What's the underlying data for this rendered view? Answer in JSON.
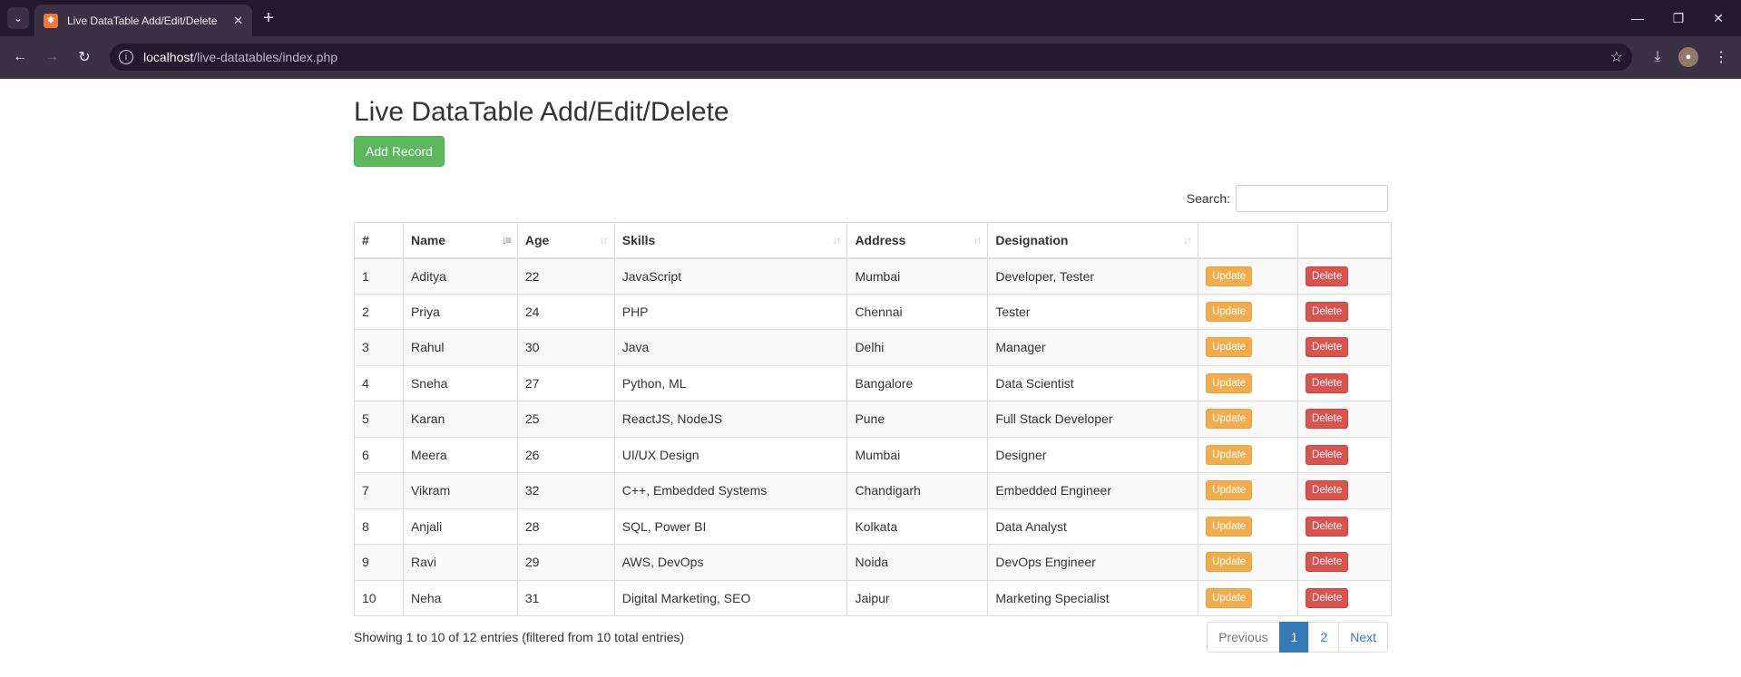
{
  "browser": {
    "tab_title": "Live DataTable Add/Edit/Delete",
    "url_host": "localhost",
    "url_path": "/live-datatables/index.php"
  },
  "page": {
    "title": "Live DataTable Add/Edit/Delete",
    "add_button": "Add Record",
    "search_label": "Search:",
    "search_value": ""
  },
  "table": {
    "headers": [
      "#",
      "Name",
      "Age",
      "Skills",
      "Address",
      "Designation",
      "",
      ""
    ],
    "update_label": "Update",
    "delete_label": "Delete",
    "rows": [
      {
        "id": "1",
        "name": "Aditya",
        "age": "22",
        "skills": "JavaScript",
        "address": "Mumbai",
        "designation": "Developer, Tester"
      },
      {
        "id": "2",
        "name": "Priya",
        "age": "24",
        "skills": "PHP",
        "address": "Chennai",
        "designation": "Tester"
      },
      {
        "id": "3",
        "name": "Rahul",
        "age": "30",
        "skills": "Java",
        "address": "Delhi",
        "designation": "Manager"
      },
      {
        "id": "4",
        "name": "Sneha",
        "age": "27",
        "skills": "Python, ML",
        "address": "Bangalore",
        "designation": "Data Scientist"
      },
      {
        "id": "5",
        "name": "Karan",
        "age": "25",
        "skills": "ReactJS, NodeJS",
        "address": "Pune",
        "designation": "Full Stack Developer"
      },
      {
        "id": "6",
        "name": "Meera",
        "age": "26",
        "skills": "UI/UX Design",
        "address": "Mumbai",
        "designation": "Designer"
      },
      {
        "id": "7",
        "name": "Vikram",
        "age": "32",
        "skills": "C++, Embedded Systems",
        "address": "Chandigarh",
        "designation": "Embedded Engineer"
      },
      {
        "id": "8",
        "name": "Anjali",
        "age": "28",
        "skills": "SQL, Power BI",
        "address": "Kolkata",
        "designation": "Data Analyst"
      },
      {
        "id": "9",
        "name": "Ravi",
        "age": "29",
        "skills": "AWS, DevOps",
        "address": "Noida",
        "designation": "DevOps Engineer"
      },
      {
        "id": "10",
        "name": "Neha",
        "age": "31",
        "skills": "Digital Marketing, SEO",
        "address": "Jaipur",
        "designation": "Marketing Specialist"
      }
    ]
  },
  "footer": {
    "info": "Showing 1 to 10 of 12 entries (filtered from 10 total entries)",
    "pagination": {
      "previous": "Previous",
      "pages": [
        "1",
        "2"
      ],
      "next": "Next"
    }
  },
  "colors": {
    "add_button": "#5cb85c",
    "update_button": "#f0ad4e",
    "delete_button": "#d9534f",
    "active_page": "#337ab7"
  }
}
